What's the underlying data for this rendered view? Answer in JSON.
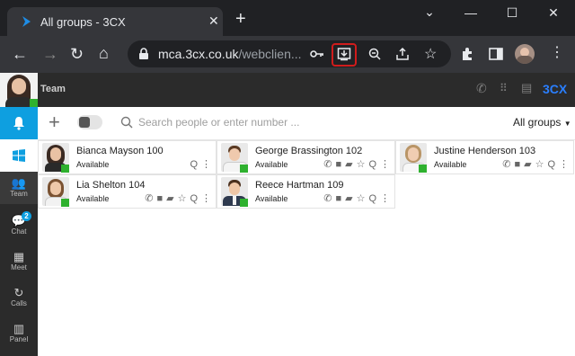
{
  "browser": {
    "tab_title": "All groups - 3CX",
    "new_tab": "+",
    "minimize": "⌄",
    "url_host": "mca.3cx.co.uk",
    "url_path": "/webclien..."
  },
  "app": {
    "header_title": "Team",
    "brand": "3CX",
    "search_placeholder": "Search people or enter number ...",
    "groups_label": "All groups",
    "accent": "#0e9fe0"
  },
  "sidebar": {
    "items": [
      {
        "label": "Team",
        "icon": "team-icon"
      },
      {
        "label": "Chat",
        "icon": "chat-icon",
        "badge": "2"
      },
      {
        "label": "Meet",
        "icon": "meet-icon"
      },
      {
        "label": "Calls",
        "icon": "calls-icon"
      },
      {
        "label": "Panel",
        "icon": "panel-icon"
      }
    ]
  },
  "contacts": [
    {
      "name": "Bianca Mayson 100",
      "status": "Available"
    },
    {
      "name": "George Brassington 102",
      "status": "Available"
    },
    {
      "name": "Justine Henderson 103",
      "status": "Available"
    },
    {
      "name": "Lia Shelton 104",
      "status": "Available"
    },
    {
      "name": "Reece Hartman 109",
      "status": "Available"
    }
  ],
  "status_color": "#2fb12f"
}
